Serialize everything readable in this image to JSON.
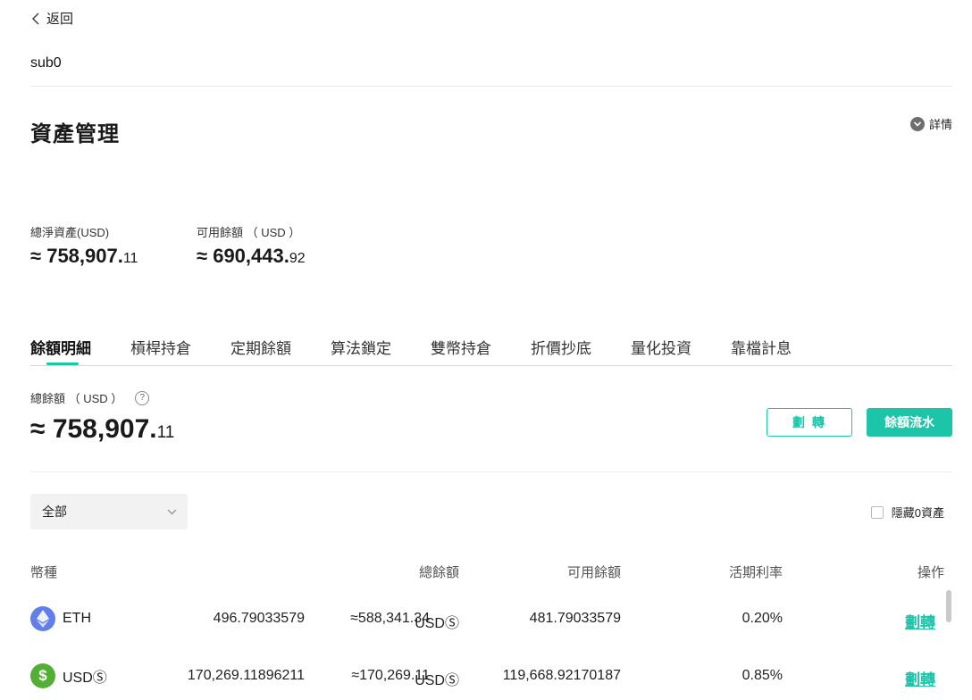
{
  "nav": {
    "back_label": "返回"
  },
  "account": {
    "name": "sub0"
  },
  "asset": {
    "title": "資產管理",
    "details_label": "詳情",
    "net_assets": {
      "label": "總淨資產(USD)",
      "approx": "≈",
      "int": "758,907.",
      "dec": "11"
    },
    "available": {
      "label": "可用餘額 （ USD ）",
      "approx": "≈",
      "int": "690,443.",
      "dec": "92"
    }
  },
  "tabs": [
    {
      "label": "餘額明細",
      "active": true
    },
    {
      "label": "槓桿持倉"
    },
    {
      "label": "定期餘額"
    },
    {
      "label": "算法鎖定"
    },
    {
      "label": "雙幣持倉"
    },
    {
      "label": "折價抄底"
    },
    {
      "label": "量化投資"
    },
    {
      "label": "靠檔計息"
    }
  ],
  "balance": {
    "label": "總餘額 （ USD ）",
    "help": "?",
    "approx": "≈",
    "int": "758,907.",
    "dec": "11",
    "transfer_label": "劃 轉",
    "flow_label": "餘額流水"
  },
  "filter": {
    "selected": "全部",
    "hide_zero_label": "隱藏0資產"
  },
  "table": {
    "headers": {
      "coin": "幣種",
      "total": "總餘額",
      "available": "可用餘額",
      "rate": "活期利率",
      "action": "操作"
    },
    "rows": [
      {
        "coin": "ETH",
        "icon": "eth-icon",
        "icon_color": "#627eea",
        "total": "496.79033579",
        "approx": "≈588,341.34",
        "unit": "USDⓈ",
        "available": "481.79033579",
        "rate": "0.20%",
        "action": "劃轉"
      },
      {
        "coin": "USDⓈ",
        "icon": "usd-icon",
        "icon_color": "#53ae35",
        "total": "170,269.11896211",
        "approx": "≈170,269.11",
        "unit": "USDⓈ",
        "available": "119,668.92170187",
        "rate": "0.85%",
        "action": "劃轉"
      }
    ]
  },
  "colors": {
    "accent": "#1cc4a8"
  }
}
